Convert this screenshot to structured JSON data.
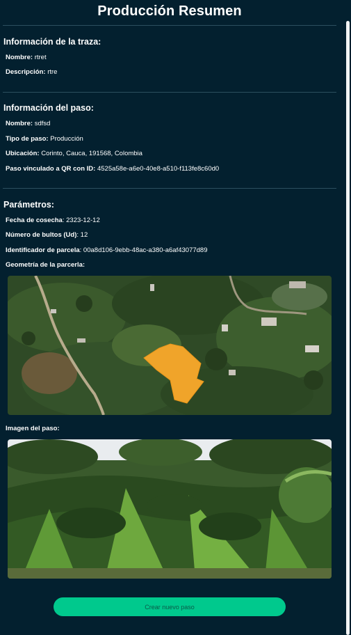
{
  "header": {
    "title": "Producción Resumen"
  },
  "trace_info": {
    "heading": "Información de la traza:",
    "fields": [
      {
        "label": "Nombre:",
        "value": "rtret"
      },
      {
        "label": "Descripción:",
        "value": "rtre"
      }
    ]
  },
  "step_info": {
    "heading": "Información del paso:",
    "fields": [
      {
        "label": "Nombre:",
        "value": "sdfsd"
      },
      {
        "label": "Tipo de paso:",
        "value": "Producción"
      },
      {
        "label": "Ubicación:",
        "value": "Corinto, Cauca, 191568, Colombia"
      },
      {
        "label": "Paso vinculado a QR con ID:",
        "value": "4525a58e-a6e0-40e8-a510-f113fe8c60d0"
      }
    ]
  },
  "parameters": {
    "heading": "Parámetros:",
    "fields": [
      {
        "label": "Fecha de cosecha",
        "value": ": 2323-12-12"
      },
      {
        "label": "Número de bultos (Ud)",
        "value": ": 12"
      },
      {
        "label": "Identificador de parcela",
        "value": ": 00a8d106-9ebb-48ac-a380-a6af43077d89"
      }
    ],
    "geometry_label": "Geometría de la parcerla:",
    "step_image_label": "Imagen del paso:"
  },
  "colors": {
    "background": "#03202f",
    "accent": "#00c98d",
    "parcel_fill": "#f0a42a"
  },
  "actions": {
    "create_step_label": "Crear nuevo paso"
  }
}
